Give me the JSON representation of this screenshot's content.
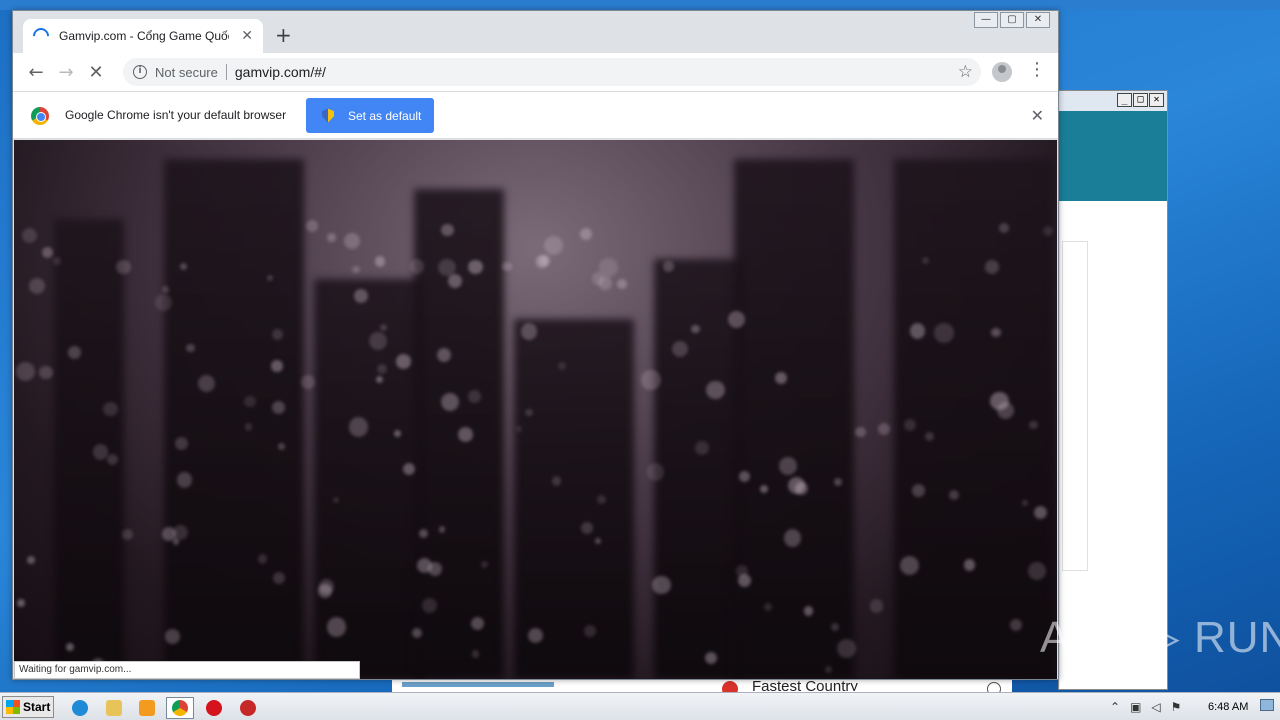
{
  "browser": {
    "tab_title": "Gamvip.com - Cổng Game Quốc Tế",
    "tab_close": "✕",
    "new_tab": "+",
    "security_label": "Not secure",
    "url": "gamvip.com/#/",
    "window_buttons": [
      "—",
      "▢",
      "✕"
    ]
  },
  "infobar": {
    "message": "Google Chrome isn't your default browser",
    "button_label": "Set as default",
    "close": "✕"
  },
  "status_bar": "Waiting for gamvip.com...",
  "background_window": {
    "buttons": [
      "_",
      "□",
      "✕"
    ],
    "peek_text": "Fastest Country"
  },
  "watermark": "ANY ▷ RUN",
  "taskbar": {
    "start_label": "Start",
    "apps": [
      "internet-explorer-icon",
      "file-explorer-icon",
      "media-player-icon",
      "chrome-icon",
      "opera-icon",
      "pdf-app-icon"
    ],
    "clock": "6:48 AM"
  }
}
